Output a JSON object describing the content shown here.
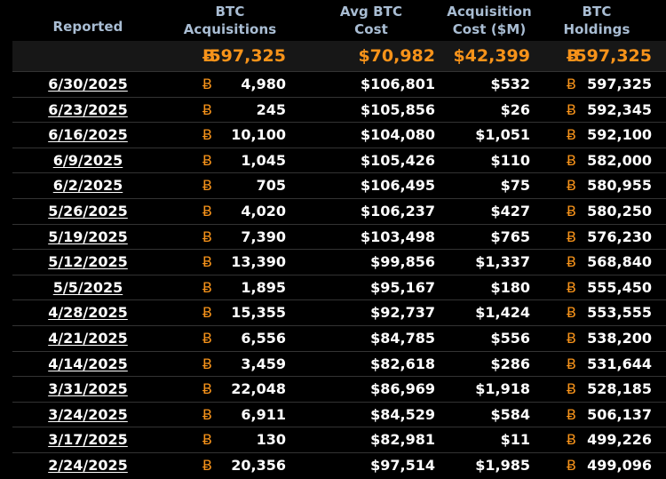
{
  "header": {
    "reported": "Reported",
    "acq_line1": "BTC",
    "acq_line2": "Acquisitions",
    "avg_line1": "Avg BTC",
    "avg_line2": "Cost",
    "cost_line1": "Acquisition",
    "cost_line2": "Cost ($M)",
    "hold_line1": "BTC",
    "hold_line2": "Holdings"
  },
  "btc_symbol": "Ƀ",
  "accent_color": "#f7931a",
  "header_color": "#a9bdd3",
  "totals": {
    "acquisitions": "597,325",
    "avg_cost": "$70,982",
    "acq_cost": "$42,399",
    "holdings": "597,325"
  },
  "rows": [
    {
      "date": "6/30/2025",
      "acq": "4,980",
      "avg": "$106,801",
      "cost": "$532",
      "hold": "597,325"
    },
    {
      "date": "6/23/2025",
      "acq": "245",
      "avg": "$105,856",
      "cost": "$26",
      "hold": "592,345"
    },
    {
      "date": "6/16/2025",
      "acq": "10,100",
      "avg": "$104,080",
      "cost": "$1,051",
      "hold": "592,100"
    },
    {
      "date": "6/9/2025",
      "acq": "1,045",
      "avg": "$105,426",
      "cost": "$110",
      "hold": "582,000"
    },
    {
      "date": "6/2/2025",
      "acq": "705",
      "avg": "$106,495",
      "cost": "$75",
      "hold": "580,955"
    },
    {
      "date": "5/26/2025",
      "acq": "4,020",
      "avg": "$106,237",
      "cost": "$427",
      "hold": "580,250"
    },
    {
      "date": "5/19/2025",
      "acq": "7,390",
      "avg": "$103,498",
      "cost": "$765",
      "hold": "576,230"
    },
    {
      "date": "5/12/2025",
      "acq": "13,390",
      "avg": "$99,856",
      "cost": "$1,337",
      "hold": "568,840"
    },
    {
      "date": "5/5/2025",
      "acq": "1,895",
      "avg": "$95,167",
      "cost": "$180",
      "hold": "555,450"
    },
    {
      "date": "4/28/2025",
      "acq": "15,355",
      "avg": "$92,737",
      "cost": "$1,424",
      "hold": "553,555"
    },
    {
      "date": "4/21/2025",
      "acq": "6,556",
      "avg": "$84,785",
      "cost": "$556",
      "hold": "538,200"
    },
    {
      "date": "4/14/2025",
      "acq": "3,459",
      "avg": "$82,618",
      "cost": "$286",
      "hold": "531,644"
    },
    {
      "date": "3/31/2025",
      "acq": "22,048",
      "avg": "$86,969",
      "cost": "$1,918",
      "hold": "528,185"
    },
    {
      "date": "3/24/2025",
      "acq": "6,911",
      "avg": "$84,529",
      "cost": "$584",
      "hold": "506,137"
    },
    {
      "date": "3/17/2025",
      "acq": "130",
      "avg": "$82,981",
      "cost": "$11",
      "hold": "499,226"
    },
    {
      "date": "2/24/2025",
      "acq": "20,356",
      "avg": "$97,514",
      "cost": "$1,985",
      "hold": "499,096"
    }
  ]
}
